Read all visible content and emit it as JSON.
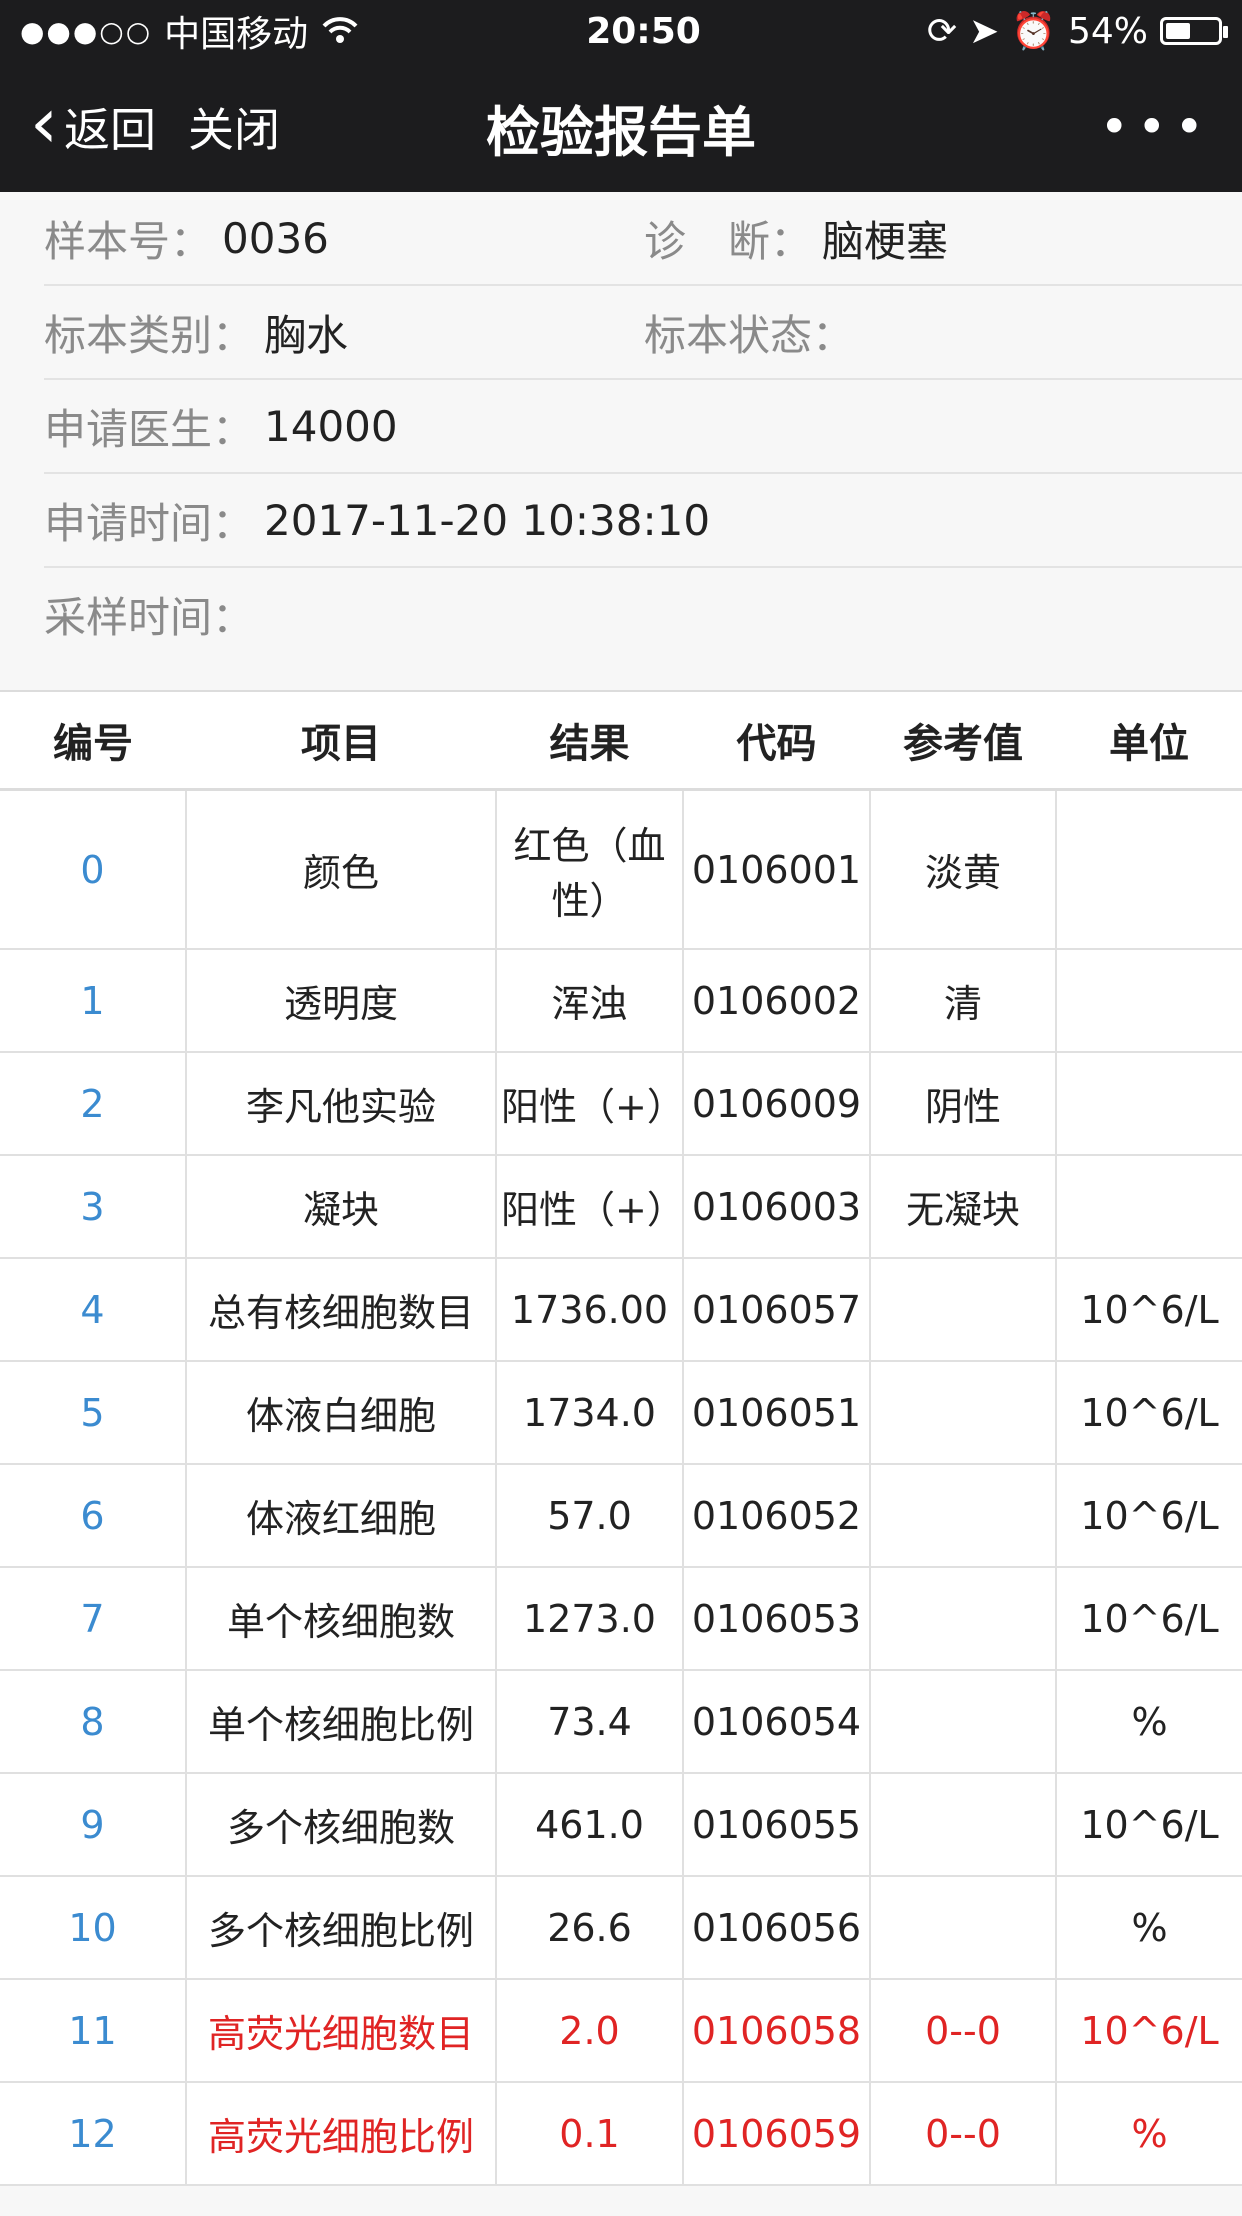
{
  "status_bar": {
    "carrier": "中国移动",
    "time": "20:50",
    "battery": "54%",
    "battery_level": 0.54
  },
  "nav": {
    "back_label": "返回",
    "close_label": "关闭",
    "title": "检验报告单",
    "more_label": "•••"
  },
  "info": {
    "sample_no_label": "样本号：",
    "sample_no": "0036",
    "diagnosis_label": "诊　断：",
    "diagnosis": "脑梗塞",
    "specimen_type_label": "标本类别：",
    "specimen_type": "胸水",
    "specimen_status_label": "标本状态：",
    "specimen_status": "",
    "doctor_label": "申请医生：",
    "doctor": "14000",
    "request_time_label": "申请时间：",
    "request_time": "2017-11-20 10:38:10",
    "sample_time_label": "采样时间：",
    "sample_time": ""
  },
  "table": {
    "headers": [
      "编号",
      "项目",
      "结果",
      "代码",
      "参考值",
      "单位"
    ],
    "rows": [
      {
        "id": "0",
        "item": "颜色",
        "result": "红色（血性）",
        "code": "0106001",
        "ref": "淡黄",
        "unit": "",
        "abnormal": false
      },
      {
        "id": "1",
        "item": "透明度",
        "result": "浑浊",
        "code": "0106002",
        "ref": "清",
        "unit": "",
        "abnormal": false
      },
      {
        "id": "2",
        "item": "李凡他实验",
        "result": "阳性（+）",
        "code": "0106009",
        "ref": "阴性",
        "unit": "",
        "abnormal": false
      },
      {
        "id": "3",
        "item": "凝块",
        "result": "阳性（+）",
        "code": "0106003",
        "ref": "无凝块",
        "unit": "",
        "abnormal": false
      },
      {
        "id": "4",
        "item": "总有核细胞数目",
        "result": "1736.00",
        "code": "0106057",
        "ref": "",
        "unit": "10^6/L",
        "abnormal": false
      },
      {
        "id": "5",
        "item": "体液白细胞",
        "result": "1734.0",
        "code": "0106051",
        "ref": "",
        "unit": "10^6/L",
        "abnormal": false
      },
      {
        "id": "6",
        "item": "体液红细胞",
        "result": "57.0",
        "code": "0106052",
        "ref": "",
        "unit": "10^6/L",
        "abnormal": false
      },
      {
        "id": "7",
        "item": "单个核细胞数",
        "result": "1273.0",
        "code": "0106053",
        "ref": "",
        "unit": "10^6/L",
        "abnormal": false
      },
      {
        "id": "8",
        "item": "单个核细胞比例",
        "result": "73.4",
        "code": "0106054",
        "ref": "",
        "unit": "%",
        "abnormal": false
      },
      {
        "id": "9",
        "item": "多个核细胞数",
        "result": "461.0",
        "code": "0106055",
        "ref": "",
        "unit": "10^6/L",
        "abnormal": false
      },
      {
        "id": "10",
        "item": "多个核细胞比例",
        "result": "26.6",
        "code": "0106056",
        "ref": "",
        "unit": "%",
        "abnormal": false
      },
      {
        "id": "11",
        "item": "高荧光细胞数目",
        "result": "2.0",
        "code": "0106058",
        "ref": "0--0",
        "unit": "10^6/L",
        "abnormal": true
      },
      {
        "id": "12",
        "item": "高荧光细胞比例",
        "result": "0.1",
        "code": "0106059",
        "ref": "0--0",
        "unit": "%",
        "abnormal": true
      }
    ]
  },
  "colors": {
    "nav_bg": "#1c1c1e",
    "link_blue": "#3b8bd0",
    "abnormal_red": "#e02424"
  }
}
